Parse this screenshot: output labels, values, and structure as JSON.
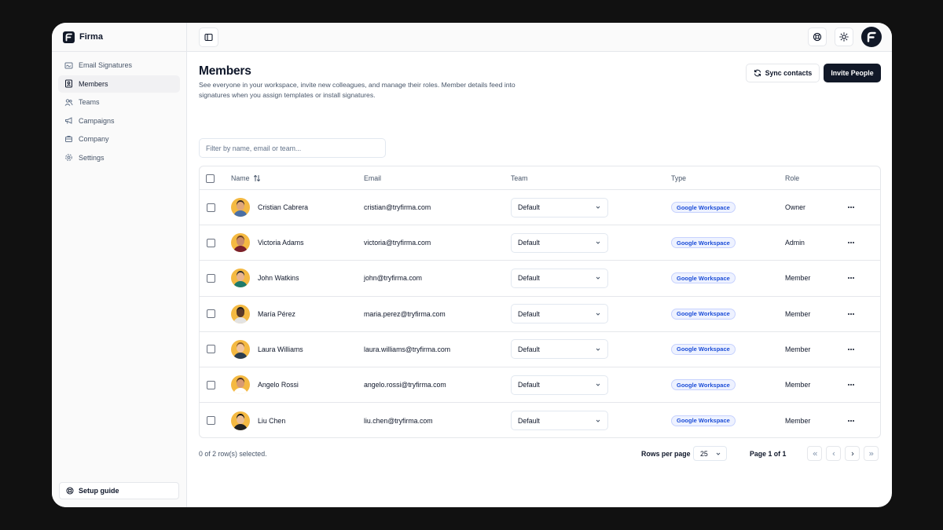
{
  "app": {
    "name": "Firma"
  },
  "sidebar": {
    "items": [
      {
        "label": "Email Signatures",
        "icon": "signature-icon",
        "active": false
      },
      {
        "label": "Members",
        "icon": "id-badge-icon",
        "active": true
      },
      {
        "label": "Teams",
        "icon": "users-icon",
        "active": false
      },
      {
        "label": "Campaigns",
        "icon": "megaphone-icon",
        "active": false
      },
      {
        "label": "Company",
        "icon": "building-icon",
        "active": false
      },
      {
        "label": "Settings",
        "icon": "gear-icon",
        "active": false
      }
    ],
    "setup_guide": "Setup guide"
  },
  "page": {
    "title": "Members",
    "description": "See everyone in your workspace, invite new colleagues, and manage their roles. Member details feed into signatures when you assign templates or install signatures.",
    "sync_label": "Sync contacts",
    "invite_label": "Invite People",
    "filter_placeholder": "Filter by name, email or team..."
  },
  "table": {
    "columns": {
      "name": "Name",
      "email": "Email",
      "team": "Team",
      "type": "Type",
      "role": "Role"
    },
    "rows": [
      {
        "name": "Cristian Cabrera",
        "email": "cristian@tryfirma.com",
        "team": "Default",
        "type": "Google Workspace",
        "role": "Owner"
      },
      {
        "name": "Victoria Adams",
        "email": "victoria@tryfirma.com",
        "team": "Default",
        "type": "Google Workspace",
        "role": "Admin"
      },
      {
        "name": "John Watkins",
        "email": "john@tryfirma.com",
        "team": "Default",
        "type": "Google Workspace",
        "role": "Member"
      },
      {
        "name": "María Pérez",
        "email": "maria.perez@tryfirma.com",
        "team": "Default",
        "type": "Google Workspace",
        "role": "Member"
      },
      {
        "name": "Laura Williams",
        "email": "laura.williams@tryfirma.com",
        "team": "Default",
        "type": "Google Workspace",
        "role": "Member"
      },
      {
        "name": "Angelo Rossi",
        "email": "angelo.rossi@tryfirma.com",
        "team": "Default",
        "type": "Google Workspace",
        "role": "Member"
      },
      {
        "name": "Liu Chen",
        "email": "liu.chen@tryfirma.com",
        "team": "Default",
        "type": "Google Workspace",
        "role": "Member"
      }
    ]
  },
  "footer": {
    "selection": "0 of 2 row(s) selected.",
    "rows_per_page_label": "Rows per page",
    "rows_per_page_value": "25",
    "page_info": "Page 1 of 1"
  },
  "colors": {
    "primary": "#111827",
    "badge_bg": "#eef2ff",
    "badge_text": "#1d4ed8",
    "avatar_bg": "#f4b942"
  }
}
